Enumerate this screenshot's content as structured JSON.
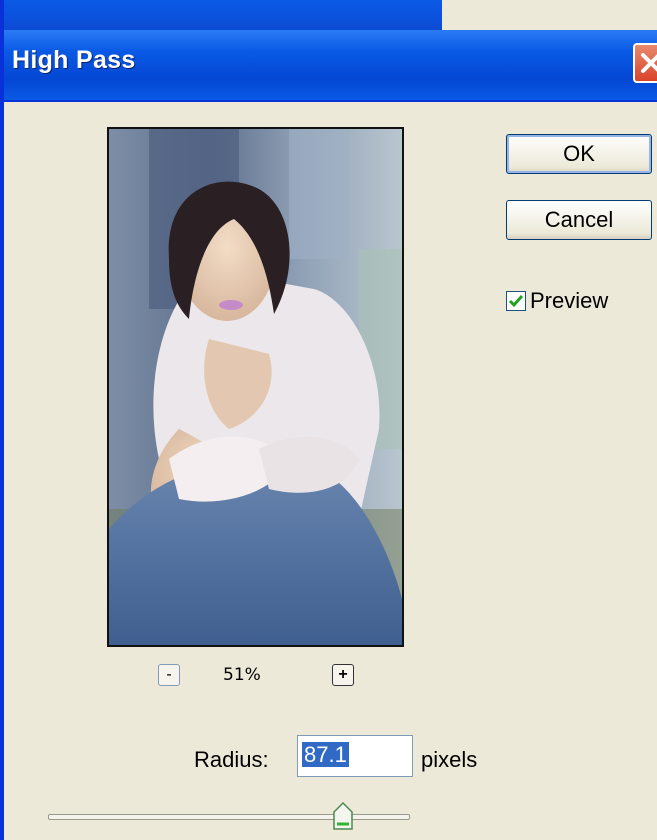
{
  "window": {
    "title": "High Pass"
  },
  "buttons": {
    "ok": "OK",
    "cancel": "Cancel"
  },
  "preview_checkbox": {
    "label": "Preview",
    "checked": true
  },
  "zoom": {
    "level": "51%",
    "minus": "-",
    "plus": "+"
  },
  "radius": {
    "label": "Radius:",
    "value": "87.1",
    "unit": "pixels"
  },
  "slider": {
    "radius_fraction": 0.82
  },
  "colors": {
    "titlebar": "#0a5ae6",
    "close_button": "#d9442a",
    "dialog_bg": "#ece9d8",
    "selection": "#316ac5",
    "checkmark": "#21a121"
  },
  "icons": {
    "close": "close-icon",
    "check": "checkmark-icon",
    "slider_thumb": "slider-thumb-icon"
  }
}
